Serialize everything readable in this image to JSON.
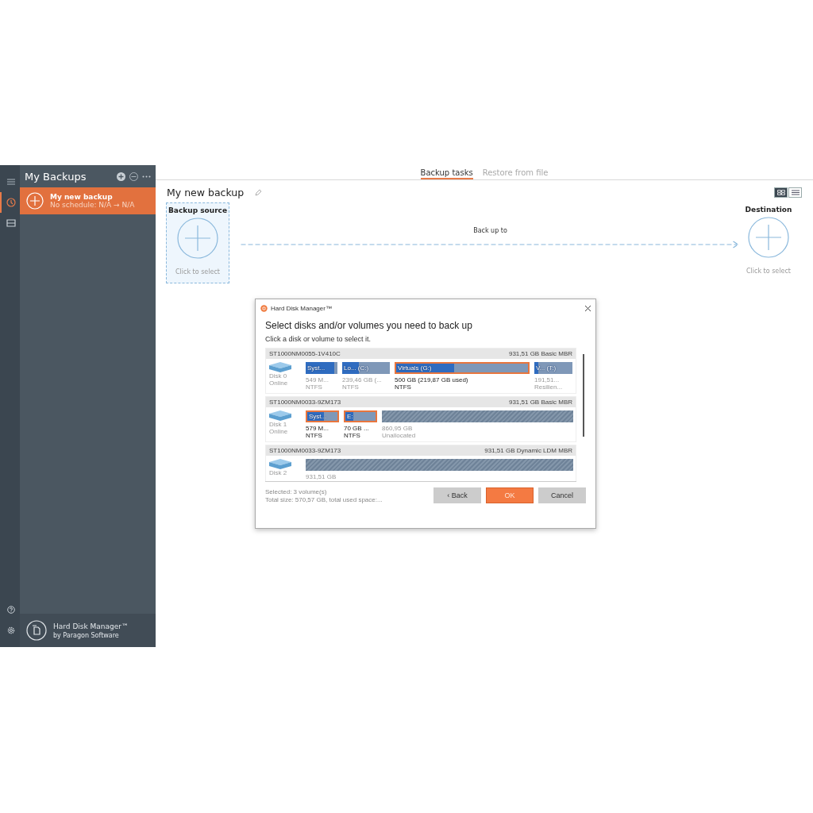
{
  "rail": {
    "items": [
      {
        "kind": "menu",
        "selected": false
      },
      {
        "kind": "clock",
        "selected": true
      },
      {
        "kind": "drive",
        "selected": false
      }
    ],
    "bottom": [
      {
        "kind": "help"
      },
      {
        "kind": "settings"
      }
    ]
  },
  "sidebar": {
    "title": "My Backups",
    "items": [
      {
        "name": "My new backup",
        "schedule": "No schedule: N/A → N/A",
        "selected": true
      }
    ],
    "footer": {
      "product": "Hard Disk Manager™",
      "vendor": "by Paragon Software"
    }
  },
  "tabs": [
    {
      "label": "Backup tasks",
      "selected": true
    },
    {
      "label": "Restore from file",
      "selected": false
    }
  ],
  "backup": {
    "title": "My new backup",
    "source": {
      "label": "Backup source",
      "hint": "Click to select"
    },
    "link": "Back up to",
    "destination": {
      "label": "Destination",
      "hint": "Click to select"
    }
  },
  "view_toggle": [
    {
      "kind": "tiles",
      "selected": true
    },
    {
      "kind": "list",
      "selected": false
    }
  ],
  "dialog": {
    "title": "Hard Disk Manager™",
    "heading": "Select disks and/or volumes you need to back up",
    "subheading": "Click a disk or volume to select it.",
    "disks": [
      {
        "model": "ST1000NM0055-1V410C",
        "info": "931,51 GB Basic MBR",
        "name": "Disk 0",
        "status": "Online",
        "volumes": [
          {
            "kind": "volume",
            "label": "Syst...",
            "level": 0.9,
            "selected": false,
            "size": "549 M...",
            "fs": "NTFS"
          },
          {
            "kind": "volume",
            "label": "Lo...  (C:)",
            "level": 0.35,
            "selected": false,
            "size": "239,46 GB (...",
            "fs": "NTFS"
          },
          {
            "kind": "volume",
            "label": "Virtuals (G:)",
            "level": 0.44,
            "selected": true,
            "size": "500 GB (219,87 GB used)",
            "fs": "NTFS"
          },
          {
            "kind": "volume",
            "label": "V...  (T:)",
            "level": 0.1,
            "selected": false,
            "size": "191,51...",
            "fs": "Resilien..."
          }
        ]
      },
      {
        "model": "ST1000NM0033-9ZM173",
        "info": "931,51 GB Basic MBR",
        "name": "Disk 1",
        "status": "Online",
        "volumes": [
          {
            "kind": "volume",
            "label": "Syst...",
            "level": 0.55,
            "selected": true,
            "size": "579 M...",
            "fs": "NTFS"
          },
          {
            "kind": "volume",
            "label": "E:",
            "level": 0.25,
            "selected": true,
            "size": "70 GB ...",
            "fs": "NTFS"
          },
          {
            "kind": "unallocated",
            "size": "860,95 GB",
            "fs": "Unallocated"
          }
        ]
      },
      {
        "model": "ST1000NM0033-9ZM173",
        "info": "931,51 GB Dynamic LDM MBR",
        "name": "Disk 2",
        "volumes": [
          {
            "kind": "unallocated",
            "size": "931,51 GB"
          }
        ]
      }
    ],
    "summary": "Selected: 3 volume(s)",
    "total": "Total size: 570,57 GB, total used space:...",
    "buttons": [
      {
        "kind": "back",
        "label": "‹ Back"
      },
      {
        "kind": "ok",
        "label": "OK"
      },
      {
        "kind": "cancel",
        "label": "Cancel"
      }
    ]
  }
}
